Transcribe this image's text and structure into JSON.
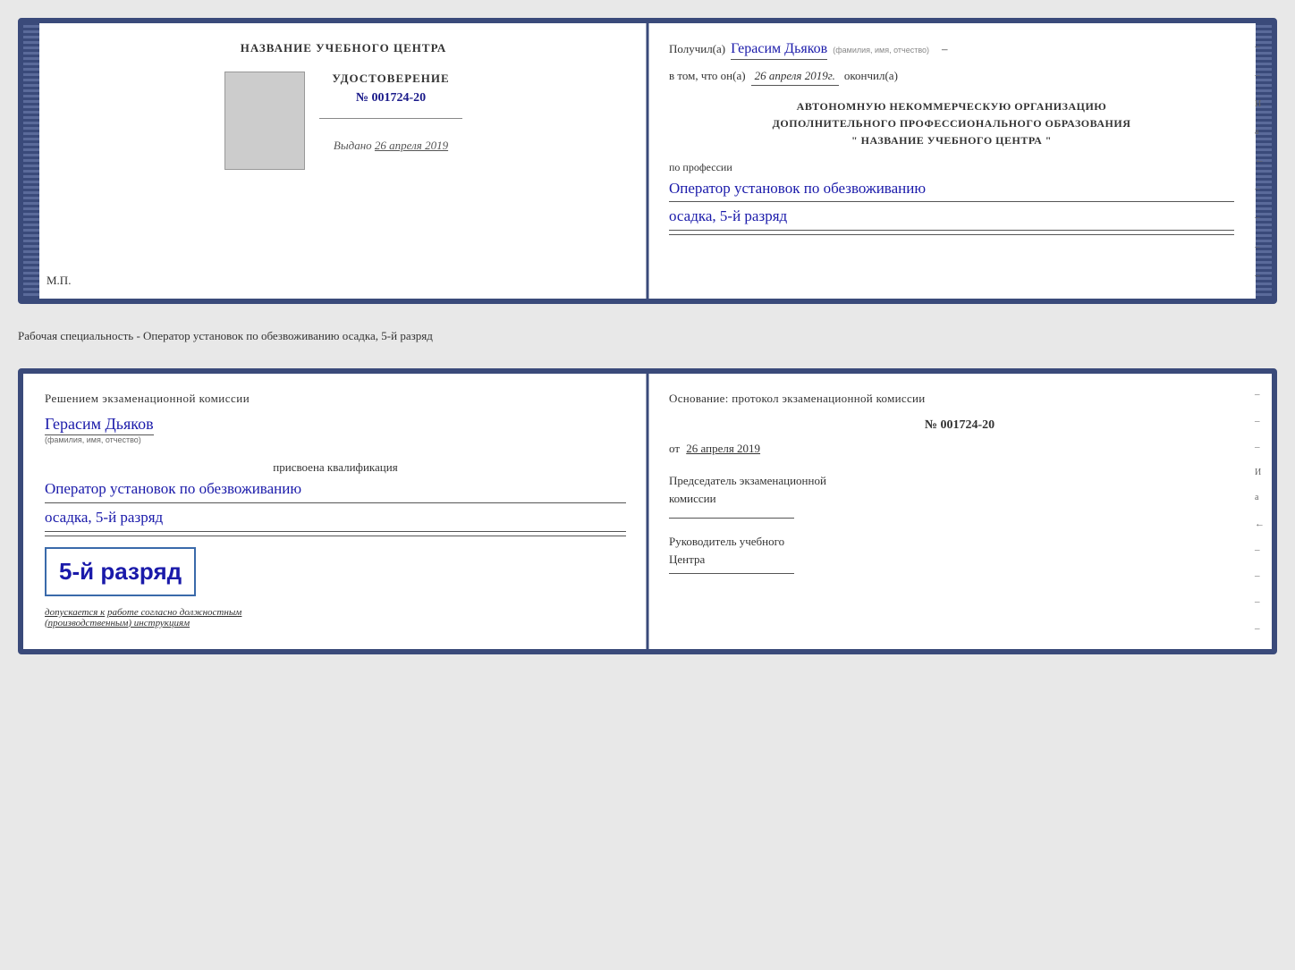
{
  "top_doc": {
    "left": {
      "title": "НАЗВАНИЕ УЧЕБНОГО ЦЕНТРА",
      "cert_label": "УДОСТОВЕРЕНИЕ",
      "cert_number_prefix": "№",
      "cert_number": "001724-20",
      "issued_label": "Выдано",
      "issued_date": "26 апреля 2019",
      "mp_label": "М.П."
    },
    "right": {
      "received_prefix": "Получил(а)",
      "recipient_name": "Герасим Дьяков",
      "recipient_sublabel": "(фамилия, имя, отчество)",
      "date_prefix": "в том, что он(а)",
      "date_value": "26 апреля 2019г.",
      "date_suffix": "окончил(а)",
      "org_line1": "АВТОНОМНУЮ НЕКОММЕРЧЕСКУЮ ОРГАНИЗАЦИЮ",
      "org_line2": "ДОПОЛНИТЕЛЬНОГО ПРОФЕССИОНАЛЬНОГО ОБРАЗОВАНИЯ",
      "org_line3": "\"  НАЗВАНИЕ УЧЕБНОГО ЦЕНТРА  \"",
      "profession_label": "по профессии",
      "profession_value": "Оператор установок по обезвоживанию",
      "rank_value": "осадка, 5-й разряд"
    }
  },
  "separator": {
    "text": "Рабочая специальность - Оператор установок по обезвоживанию осадка, 5-й разряд"
  },
  "bottom_doc": {
    "left": {
      "decision_title": "Решением экзаменационной комиссии",
      "person_name": "Герасим Дьяков",
      "person_sublabel": "(фамилия, имя, отчество)",
      "assigned_label": "присвоена квалификация",
      "qualification_line1": "Оператор установок по обезвоживанию",
      "qualification_line2": "осадка, 5-й разряд",
      "stamp_rank": "5-й разряд",
      "stamp_permission_prefix": "допускается к",
      "stamp_permission_text": "работе согласно должностным",
      "stamp_permission_text2": "(производственным) инструкциям"
    },
    "right": {
      "basis_label": "Основание: протокол экзаменационной комиссии",
      "protocol_number": "№ 001724-20",
      "date_prefix": "от",
      "date_value": "26 апреля 2019",
      "chairman_label": "Председатель экзаменационной",
      "chairman_label2": "комиссии",
      "director_label": "Руководитель учебного",
      "director_label2": "Центра"
    }
  }
}
